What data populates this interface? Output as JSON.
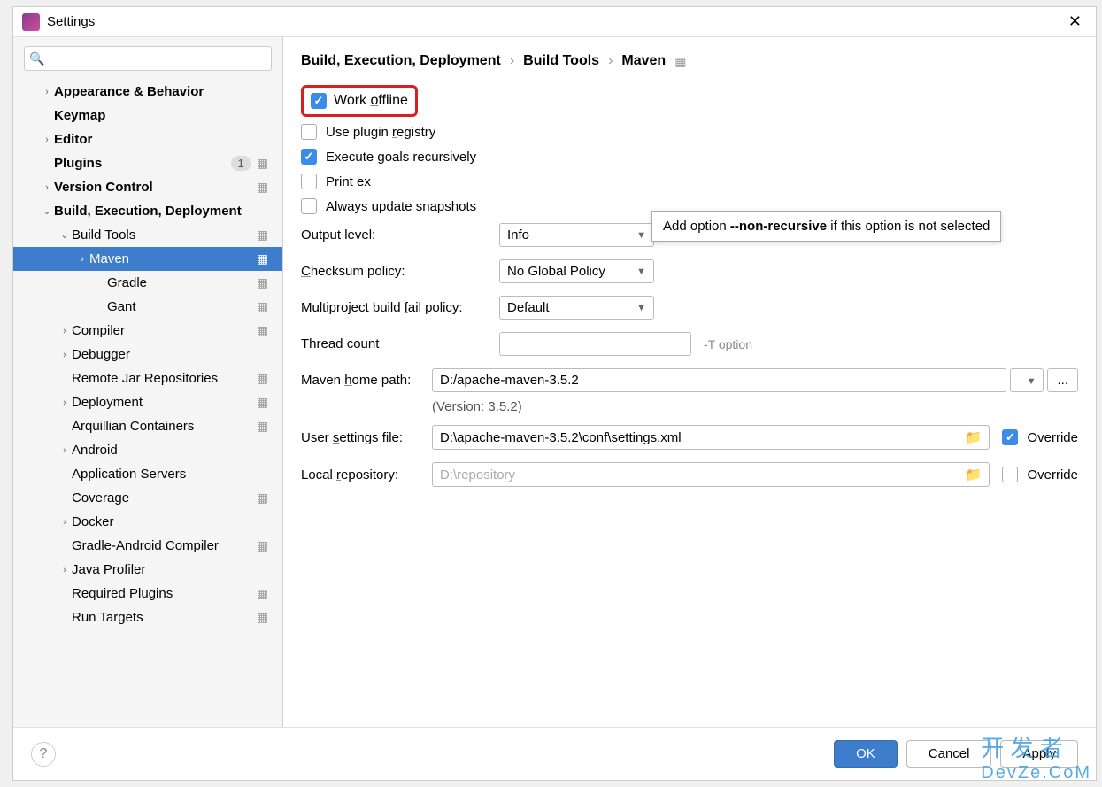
{
  "window": {
    "title": "Settings"
  },
  "search": {
    "placeholder": ""
  },
  "tree": {
    "items": [
      {
        "label": "Appearance & Behavior",
        "bold": true,
        "chevron": "›",
        "indent": 1
      },
      {
        "label": "Keymap",
        "bold": true,
        "indent": 1
      },
      {
        "label": "Editor",
        "bold": true,
        "chevron": "›",
        "indent": 1
      },
      {
        "label": "Plugins",
        "bold": true,
        "indent": 1,
        "badge": "1",
        "gear": true
      },
      {
        "label": "Version Control",
        "bold": true,
        "chevron": "›",
        "indent": 1,
        "gear": true
      },
      {
        "label": "Build, Execution, Deployment",
        "bold": true,
        "chevron": "⌄",
        "indent": 1
      },
      {
        "label": "Build Tools",
        "chevron": "⌄",
        "indent": 2,
        "gear": true
      },
      {
        "label": "Maven",
        "chevron": "›",
        "indent": 3,
        "selected": true,
        "gear": true
      },
      {
        "label": "Gradle",
        "indent": 4,
        "gear": true
      },
      {
        "label": "Gant",
        "indent": 4,
        "gear": true
      },
      {
        "label": "Compiler",
        "chevron": "›",
        "indent": 2,
        "gear": true
      },
      {
        "label": "Debugger",
        "chevron": "›",
        "indent": 2
      },
      {
        "label": "Remote Jar Repositories",
        "indent": 2,
        "gear": true
      },
      {
        "label": "Deployment",
        "chevron": "›",
        "indent": 2,
        "gear": true
      },
      {
        "label": "Arquillian Containers",
        "indent": 2,
        "gear": true
      },
      {
        "label": "Android",
        "chevron": "›",
        "indent": 2
      },
      {
        "label": "Application Servers",
        "indent": 2
      },
      {
        "label": "Coverage",
        "indent": 2,
        "gear": true
      },
      {
        "label": "Docker",
        "chevron": "›",
        "indent": 2
      },
      {
        "label": "Gradle-Android Compiler",
        "indent": 2,
        "gear": true
      },
      {
        "label": "Java Profiler",
        "chevron": "›",
        "indent": 2
      },
      {
        "label": "Required Plugins",
        "indent": 2,
        "gear": true
      },
      {
        "label": "Run Targets",
        "indent": 2,
        "gear": true
      }
    ]
  },
  "breadcrumb": {
    "p1": "Build, Execution, Deployment",
    "p2": "Build Tools",
    "p3": "Maven"
  },
  "options": {
    "work_offline": "Work offline",
    "use_plugin_registry": "Use plugin registry",
    "execute_goals": "Execute goals recursively",
    "print_exception": "Print ex",
    "always_update": "Always update snapshots"
  },
  "tooltip": {
    "pre": "Add option ",
    "opt": "--non-recursive",
    "post": " if this option is not selected"
  },
  "form": {
    "output_level_label": "Output level:",
    "output_level_value": "Info",
    "checksum_label": "Checksum policy:",
    "checksum_value": "No Global Policy",
    "multiproject_label": "Multiproject build fail policy:",
    "multiproject_value": "Default",
    "thread_label": "Thread count",
    "thread_hint": "-T option",
    "maven_home_label": "Maven home path:",
    "maven_home_value": "D:/apache-maven-3.5.2",
    "version_note": "(Version: 3.5.2)",
    "user_settings_label": "User settings file:",
    "user_settings_value": "D:\\apache-maven-3.5.2\\conf\\settings.xml",
    "local_repo_label": "Local repository:",
    "local_repo_value": "D:\\repository",
    "override": "Override"
  },
  "buttons": {
    "ok": "OK",
    "cancel": "Cancel",
    "apply": "Apply"
  },
  "watermark": {
    "line1": "开 发 者",
    "line2": "DevZe.CoM"
  }
}
